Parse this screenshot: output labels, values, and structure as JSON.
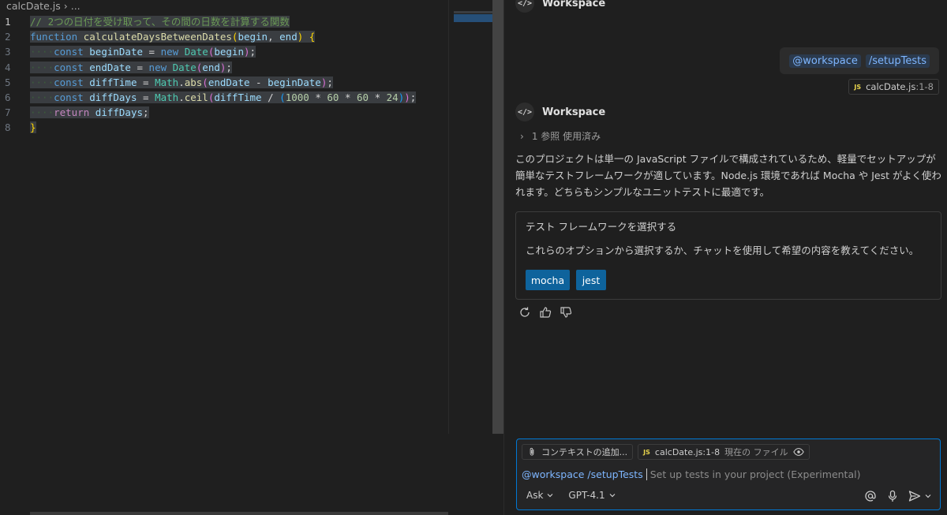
{
  "editor": {
    "breadcrumb": {
      "file": "calcDate.js",
      "more": "..."
    },
    "line_numbers": [
      "1",
      "2",
      "3",
      "4",
      "5",
      "6",
      "7",
      "8"
    ],
    "code": {
      "l1_comment": "// 2つの日付を受け取って、その間の日数を計算する関数",
      "kw_function": "function",
      "fn_name": "calculateDaysBetweenDates",
      "p_begin": "begin",
      "p_end": "end",
      "kw_const": "const",
      "v_beginDate": "beginDate",
      "v_endDate": "endDate",
      "v_diffTime": "diffTime",
      "v_diffDays": "diffDays",
      "kw_new": "new",
      "cls_Date": "Date",
      "cls_Math": "Math",
      "fn_abs": "abs",
      "fn_ceil": "ceil",
      "n1000": "1000",
      "n60": "60",
      "n24": "24",
      "kw_return": "return"
    }
  },
  "chat": {
    "top_agent": "Workspace",
    "user_message": {
      "agent": "@workspace",
      "command": "/setupTests"
    },
    "user_reference": {
      "lang": "JS",
      "file": "calcDate.js",
      "range": ":1-8"
    },
    "response_agent": "Workspace",
    "refs_used": "1 参照 使用済み",
    "answer": "このプロジェクトは単一の JavaScript ファイルで構成されているため、軽量でセットアップが簡単なテストフレームワークが適しています。Node.js 環境であれば Mocha や Jest がよく使われます。どちらもシンプルなユニットテストに最適です。",
    "choice": {
      "title": "テスト フレームワークを選択する",
      "description": "これらのオプションから選択するか、チャットを使用して希望の内容を教えてください。",
      "options": [
        "mocha",
        "jest"
      ]
    }
  },
  "input": {
    "add_context": "コンテキストの追加...",
    "current_file": {
      "lang": "JS",
      "file": "calcDate.js",
      "range": ":1-8",
      "label": "現在の ファイル"
    },
    "prompt_agent": "@workspace",
    "prompt_command": "/setupTests",
    "placeholder": "Set up tests in your project (Experimental)",
    "mode": "Ask",
    "model": "GPT-4.1"
  },
  "icons": [
    "chevron-right-icon",
    "code-icon",
    "js-icon",
    "retry-icon",
    "thumbs-up-icon",
    "thumbs-down-icon",
    "paperclip-icon",
    "eye-icon",
    "at-icon",
    "mic-icon",
    "send-icon",
    "chevron-down-icon"
  ]
}
